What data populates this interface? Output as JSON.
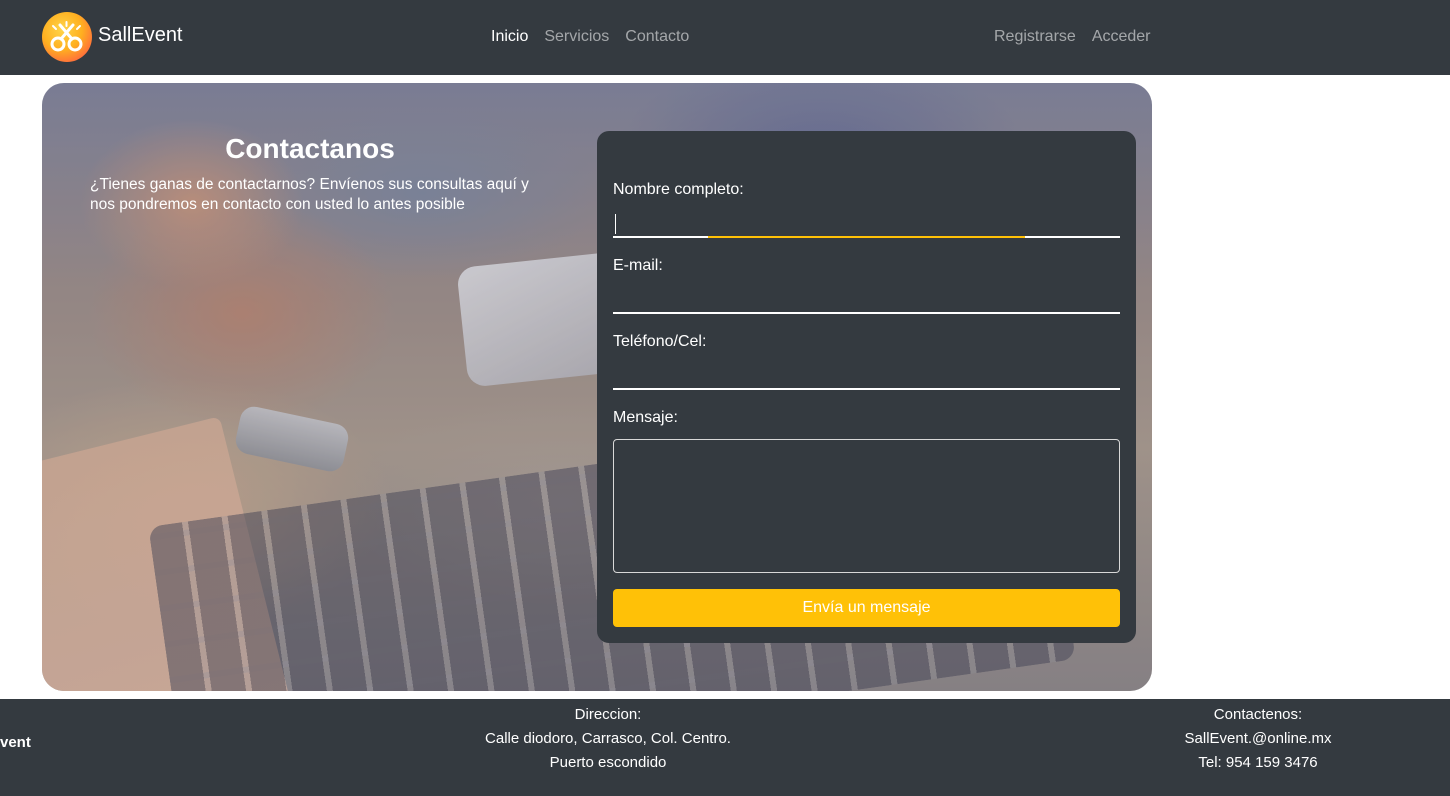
{
  "nav": {
    "brand": "SallEvent",
    "links": [
      "Inicio",
      "Servicios",
      "Contacto"
    ],
    "auth": [
      "Registrarse",
      "Acceder"
    ]
  },
  "hero": {
    "title": "Contactanos",
    "description": "¿Tienes ganas de contactarnos? Envíenos sus consultas aquí y nos pondremos en contacto con usted lo antes posible"
  },
  "form": {
    "name_label": "Nombre completo:",
    "email_label": "E-mail:",
    "phone_label": "Teléfono/Cel:",
    "message_label": "Mensaje:",
    "submit_label": "Envía un mensaje"
  },
  "footer": {
    "brand": "vent",
    "address_title": "Direccion:",
    "address_line1": "Calle diodoro, Carrasco, Col. Centro.",
    "address_line2": "Puerto escondido",
    "contact_title": "Contactenos:",
    "email": "SallEvent.@online.mx",
    "phone": "Tel: 954 159 3476"
  },
  "colors": {
    "dark": "#343a40",
    "accent": "#ffc107"
  }
}
